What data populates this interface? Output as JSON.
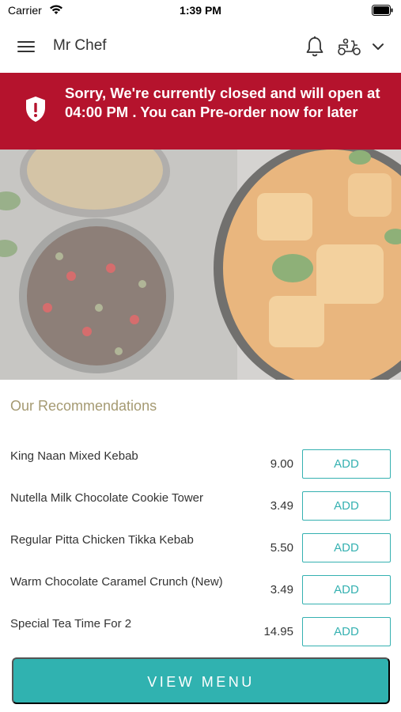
{
  "status_bar": {
    "carrier": "Carrier",
    "time": "1:39 PM"
  },
  "app_bar": {
    "title": "Mr Chef",
    "icons": [
      "menu-icon",
      "bell-icon",
      "delivery-scooter-icon",
      "chevron-down-icon"
    ]
  },
  "banner": {
    "message": "Sorry, We're currently closed and will open at 04:00 PM . You can Pre-order now for later",
    "icon": "shield-exclamation-icon",
    "color": "#b5132d"
  },
  "recommendations": {
    "title": "Our Recommendations",
    "items": [
      {
        "name": "King Naan Mixed Kebab",
        "price": "9.00",
        "button": "ADD"
      },
      {
        "name": "Nutella Milk Chocolate Cookie Tower",
        "price": "3.49",
        "button": "ADD"
      },
      {
        "name": "Regular Pitta Chicken Tikka Kebab",
        "price": "5.50",
        "button": "ADD"
      },
      {
        "name": "Warm Chocolate Caramel Crunch (New)",
        "price": "3.49",
        "button": "ADD"
      },
      {
        "name": "Special Tea Time For 2",
        "price": "14.95",
        "button": "ADD"
      }
    ]
  },
  "view_menu": {
    "label": "VIEW MENU",
    "color": "#30b2b0"
  },
  "accent_color": "#35b1b1"
}
